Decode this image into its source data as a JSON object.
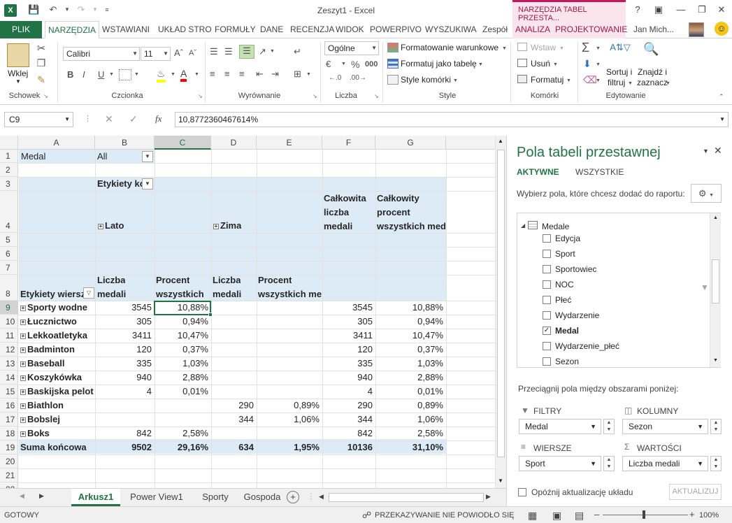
{
  "window": {
    "title": "Zeszyt1 - Excel",
    "context_title": "NARZĘDZIA TABEL PRZESTA..."
  },
  "tabs": {
    "file": "PLIK",
    "items": [
      "NARZĘDZIA",
      "WSTAWIANI",
      "UKŁAD STRO",
      "FORMUŁY",
      "DANE",
      "RECENZJA",
      "WIDOK",
      "POWERPIVO",
      "WYSZUKIWA",
      "Zespół"
    ],
    "ctx": [
      "ANALIZA",
      "PROJEKTOWANIE"
    ],
    "user": "Jan Mich..."
  },
  "ribbon": {
    "paste_label": "Wklej",
    "font_name": "Calibri",
    "font_size": "11",
    "number_format": "Ogólne",
    "cond_format": "Formatowanie warunkowe",
    "format_table": "Formatuj jako tabelę",
    "cell_styles": "Style komórki",
    "insert": "Wstaw",
    "delete": "Usuń",
    "format": "Formatuj",
    "sort_filter_1": "Sortuj i",
    "sort_filter_2": "filtruj",
    "find_1": "Znajdź i",
    "find_2": "zaznacz",
    "groups": {
      "clipboard": "Schowek",
      "font": "Czcionka",
      "alignment": "Wyrównanie",
      "number": "Liczba",
      "styles": "Style",
      "cells": "Komórki",
      "editing": "Edytowanie"
    }
  },
  "formula_bar": {
    "name_box": "C9",
    "fx": "fx",
    "value": "10,8772360467614%"
  },
  "grid": {
    "columns": [
      "A",
      "B",
      "C",
      "D",
      "E",
      "F",
      "G"
    ],
    "rows": [
      "1",
      "2",
      "3",
      "4",
      "5",
      "6",
      "7",
      "8",
      "9",
      "10",
      "11",
      "12",
      "13",
      "14",
      "15",
      "16",
      "17",
      "18",
      "19",
      "20",
      "21",
      "22"
    ],
    "r1": {
      "a": "Medal",
      "b": "All"
    },
    "r3_b": "Etykiety ko",
    "r3_f1": "Całkowita",
    "r3_f2": "liczba",
    "r3_f3": "medali",
    "r3_g1": "Całkowity",
    "r3_g2": "procent",
    "r3_g3": "wszystkich meda",
    "r4_lato": "Lato",
    "r4_zima": "Zima",
    "r8": {
      "a": "Etykiety wiersz",
      "b1": "Liczba",
      "b2": "medali",
      "c1": "Procent",
      "c2": "wszystkich",
      "d1": "Liczba",
      "d2": "medali",
      "e1": "Procent",
      "e2": "wszystkich me"
    },
    "data": [
      [
        "Sporty wodne",
        "3545",
        "10,88%",
        "",
        "",
        "3545",
        "10,88%"
      ],
      [
        "Łucznictwo",
        "305",
        "0,94%",
        "",
        "",
        "305",
        "0,94%"
      ],
      [
        "Lekkoatletyka",
        "3411",
        "10,47%",
        "",
        "",
        "3411",
        "10,47%"
      ],
      [
        "Badminton",
        "120",
        "0,37%",
        "",
        "",
        "120",
        "0,37%"
      ],
      [
        "Baseball",
        "335",
        "1,03%",
        "",
        "",
        "335",
        "1,03%"
      ],
      [
        "Koszykówka",
        "940",
        "2,88%",
        "",
        "",
        "940",
        "2,88%"
      ],
      [
        "Baskijska pelot",
        "4",
        "0,01%",
        "",
        "",
        "4",
        "0,01%"
      ],
      [
        "Biathlon",
        "",
        "",
        "290",
        "0,89%",
        "290",
        "0,89%"
      ],
      [
        "Bobslej",
        "",
        "",
        "344",
        "1,06%",
        "344",
        "1,06%"
      ],
      [
        "Boks",
        "842",
        "2,58%",
        "",
        "",
        "842",
        "2,58%"
      ]
    ],
    "total": [
      "Suma końcowa",
      "9502",
      "29,16%",
      "634",
      "1,95%",
      "10136",
      "31,10%"
    ]
  },
  "sheets": [
    "Arkusz1",
    "Power View1",
    "Sporty",
    "Gospoda"
  ],
  "pane": {
    "title": "Pola tabeli przestawnej",
    "tab_active": "AKTYWNE",
    "tab_all": "WSZYSTKIE",
    "prompt": "Wybierz pola, które chcesz dodać do raportu:",
    "table_name": "Medale",
    "fields": [
      {
        "name": "Edycja",
        "checked": false
      },
      {
        "name": "Sport",
        "checked": false
      },
      {
        "name": "Sportowiec",
        "checked": false
      },
      {
        "name": "NOC",
        "checked": false
      },
      {
        "name": "Płeć",
        "checked": false
      },
      {
        "name": "Wydarzenie",
        "checked": false
      },
      {
        "name": "Medal",
        "checked": true
      },
      {
        "name": "Wydarzenie_płeć",
        "checked": false
      },
      {
        "name": "Sezon",
        "checked": false
      }
    ],
    "drag_prompt": "Przeciągnij pola między obszarami poniżej:",
    "filters_label": "FILTRY",
    "columns_label": "KOLUMNY",
    "rows_label": "WIERSZE",
    "values_label": "WARTOŚCI",
    "filters_value": "Medal",
    "columns_value": "Sezon",
    "rows_value": "Sport",
    "values_value": "Liczba medali",
    "defer_label": "Opóźnij aktualizację układu",
    "update_btn": "AKTUALIZUJ"
  },
  "status": {
    "ready": "GOTOWY",
    "message": "PRZEKAZYWANIE NIE POWIODŁO SIĘ",
    "zoom": "100%"
  },
  "colors": {
    "accent": "#217346",
    "context": "#c3185f",
    "pivot_fill": "#ddebf7"
  }
}
